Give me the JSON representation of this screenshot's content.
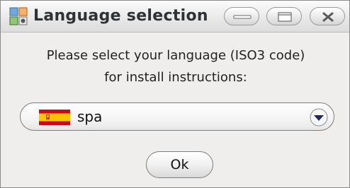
{
  "window": {
    "title": "Language selection",
    "buttons": {
      "minimize_icon": "minimize-icon",
      "maximize_icon": "maximize-icon",
      "close_icon": "close-icon"
    }
  },
  "prompt": {
    "line1": "Please select your language (ISO3 code)",
    "line2": "for install instructions:"
  },
  "language_select": {
    "selected_value": "spa",
    "flag_icon": "spain-flag-icon"
  },
  "actions": {
    "ok_label": "Ok"
  },
  "colors": {
    "window_bg": "#efeeec",
    "flag_red": "#c60b1e",
    "flag_yellow": "#ffc400"
  }
}
